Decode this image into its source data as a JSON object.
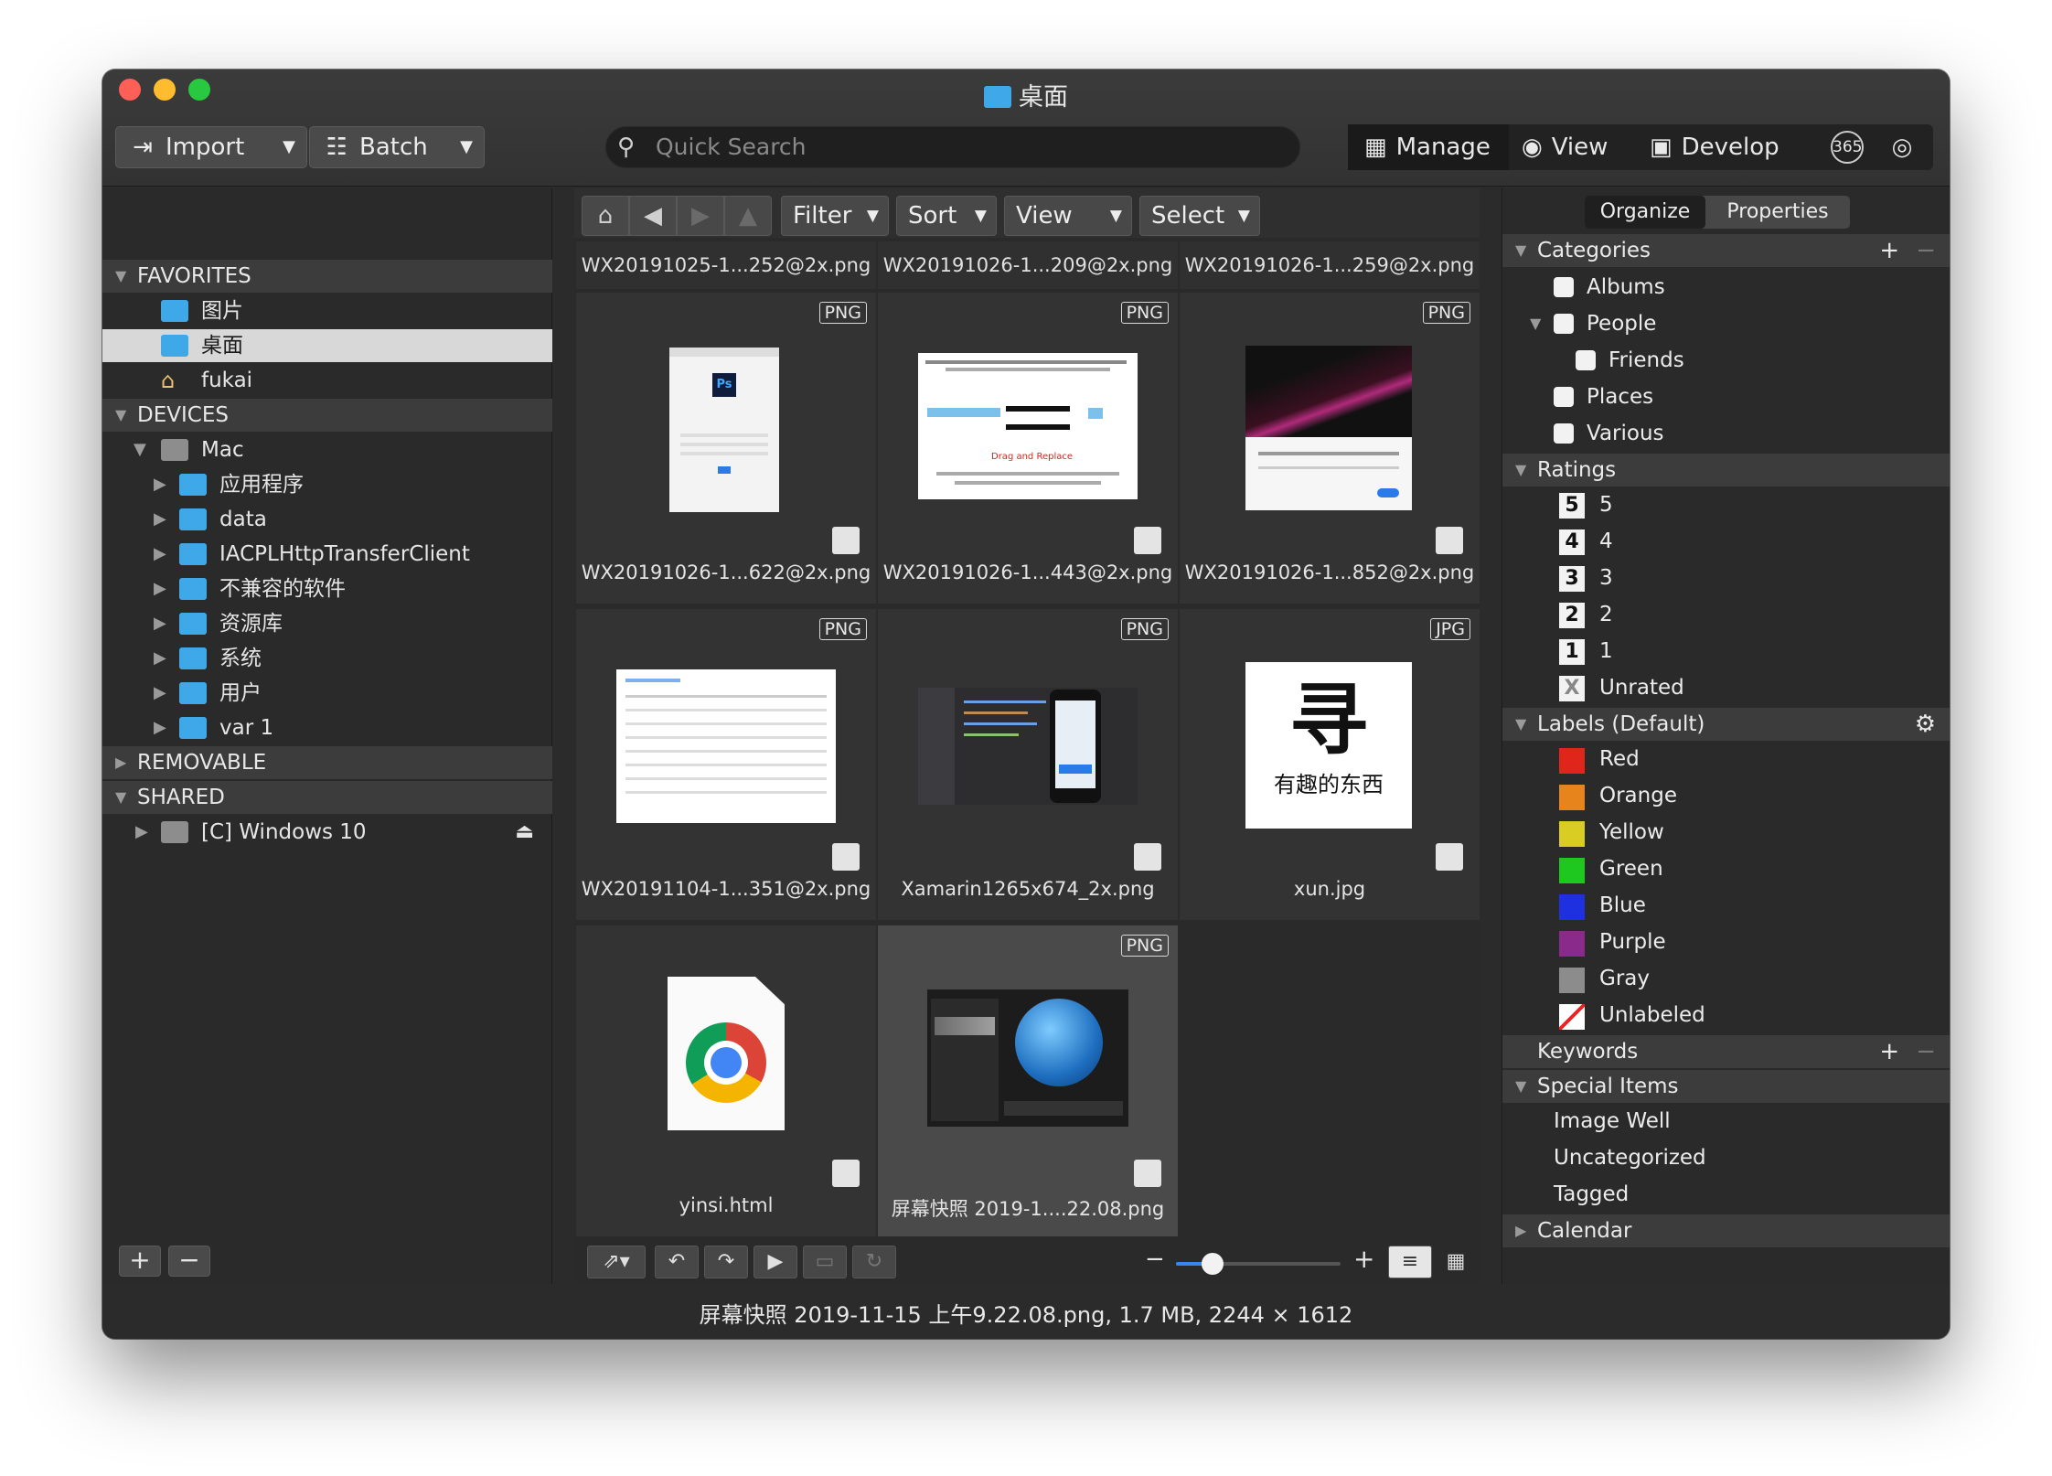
{
  "window": {
    "title": "桌面"
  },
  "toolbar": {
    "import_label": "Import",
    "batch_label": "Batch",
    "search_placeholder": "Quick Search",
    "modes": [
      {
        "label": "Manage",
        "icon": "grid-icon",
        "active": true
      },
      {
        "label": "View",
        "icon": "eye-icon",
        "active": false
      },
      {
        "label": "Develop",
        "icon": "develop-icon",
        "active": false
      }
    ],
    "extra_365": "365"
  },
  "sidebar": {
    "favorites_header": "FAVORITES",
    "favorites": [
      {
        "label": "图片",
        "icon": "pictures-folder-icon"
      },
      {
        "label": "桌面",
        "icon": "desktop-folder-icon",
        "selected": true
      },
      {
        "label": "fukai",
        "icon": "home-icon"
      }
    ],
    "devices_header": "DEVICES",
    "device_root": "Mac",
    "device_items": [
      "应用程序",
      "data",
      "IACPLHttpTransferClient",
      "不兼容的软件",
      "资源库",
      "系统",
      "用户",
      "var 1"
    ],
    "removable_header": "REMOVABLE",
    "shared_header": "SHARED",
    "shared_items": [
      "[C] Windows 10"
    ],
    "add_label": "+",
    "remove_label": "−"
  },
  "browser": {
    "nav": {
      "filter": "Filter",
      "sort": "Sort",
      "view": "View",
      "select": "Select"
    },
    "top_row_names": [
      "WX20191025-1...252@2x.png",
      "WX20191026-1...209@2x.png",
      "WX20191026-1...259@2x.png"
    ],
    "cells": [
      {
        "name": "WX20191026-1...622@2x.png",
        "badge": "PNG"
      },
      {
        "name": "WX20191026-1...443@2x.png",
        "badge": "PNG"
      },
      {
        "name": "WX20191026-1...852@2x.png",
        "badge": "PNG"
      },
      {
        "name": "WX20191104-1...351@2x.png",
        "badge": "PNG"
      },
      {
        "name": "Xamarin1265x674_2x.png",
        "badge": "PNG"
      },
      {
        "name": "xun.jpg",
        "badge": "JPG"
      },
      {
        "name": "yinsi.html",
        "badge": ""
      },
      {
        "name": "屏幕快照 2019-1....22.08.png",
        "badge": "PNG",
        "selected": true
      }
    ],
    "thumb_text": {
      "ps_label": "Ps",
      "drag_replace": "Drag and Replace",
      "xun_glyph": "寻",
      "xun_caption": "有趣的东西"
    },
    "zoom_level": 0.22,
    "zoom_minus": "−",
    "zoom_plus": "+"
  },
  "rightpanel": {
    "tabs": [
      "Organize",
      "Properties"
    ],
    "categories_header": "Categories",
    "categories": [
      {
        "label": "Albums",
        "indent": 1
      },
      {
        "label": "People",
        "indent": 1,
        "expanded": true
      },
      {
        "label": "Friends",
        "indent": 2
      },
      {
        "label": "Places",
        "indent": 1
      },
      {
        "label": "Various",
        "indent": 1
      }
    ],
    "ratings_header": "Ratings",
    "ratings": [
      {
        "box": "5",
        "label": "5"
      },
      {
        "box": "4",
        "label": "4"
      },
      {
        "box": "3",
        "label": "3"
      },
      {
        "box": "2",
        "label": "2"
      },
      {
        "box": "1",
        "label": "1"
      },
      {
        "box": "X",
        "label": "Unrated"
      }
    ],
    "labels_header": "Labels (Default)",
    "labels": [
      {
        "label": "Red",
        "color": "#e0261b"
      },
      {
        "label": "Orange",
        "color": "#e8841c"
      },
      {
        "label": "Yellow",
        "color": "#d9cc23"
      },
      {
        "label": "Green",
        "color": "#1ec81e"
      },
      {
        "label": "Blue",
        "color": "#1e30e0"
      },
      {
        "label": "Purple",
        "color": "#8a2a8a"
      },
      {
        "label": "Gray",
        "color": "#8c8c8c"
      },
      {
        "label": "Unlabeled",
        "color": "#ffffff"
      }
    ],
    "keywords_header": "Keywords",
    "special_header": "Special Items",
    "special_items": [
      "Image Well",
      "Uncategorized",
      "Tagged"
    ],
    "calendar_header": "Calendar"
  },
  "status": "屏幕快照 2019-11-15 上午9.22.08.png, 1.7 MB, 2244 × 1612"
}
